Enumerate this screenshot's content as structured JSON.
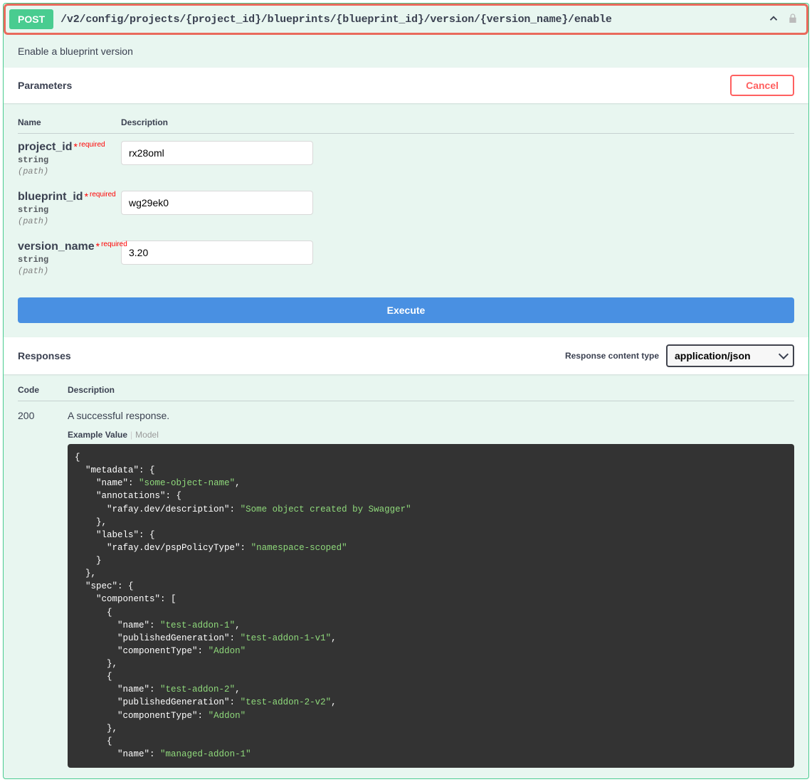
{
  "summary": {
    "method": "POST",
    "path": "/v2/config/projects/{project_id}/blueprints/{blueprint_id}/version/{version_name}/enable",
    "description": "Enable a blueprint version"
  },
  "parameters": {
    "title": "Parameters",
    "cancel_label": "Cancel",
    "head_name": "Name",
    "head_desc": "Description",
    "required_text": "required",
    "items": [
      {
        "name": "project_id",
        "type": "string",
        "in": "(path)",
        "value": "rx28oml"
      },
      {
        "name": "blueprint_id",
        "type": "string",
        "in": "(path)",
        "value": "wg29ek0"
      },
      {
        "name": "version_name",
        "type": "string",
        "in": "(path)",
        "value": "3.20"
      }
    ]
  },
  "execute_label": "Execute",
  "responses": {
    "title": "Responses",
    "content_type_label": "Response content type",
    "content_type_value": "application/json",
    "head_code": "Code",
    "head_desc": "Description",
    "code": "200",
    "desc": "A successful response.",
    "tab_example": "Example Value",
    "tab_model": "Model"
  },
  "example_json": {
    "metadata": {
      "name": "some-object-name",
      "annotations": {
        "rafay.dev/description": "Some object created by Swagger"
      },
      "labels": {
        "rafay.dev/pspPolicyType": "namespace-scoped"
      }
    },
    "spec": {
      "components": [
        {
          "name": "test-addon-1",
          "publishedGeneration": "test-addon-1-v1",
          "componentType": "Addon"
        },
        {
          "name": "test-addon-2",
          "publishedGeneration": "test-addon-2-v2",
          "componentType": "Addon"
        },
        {
          "name": "managed-addon-1"
        }
      ]
    }
  }
}
